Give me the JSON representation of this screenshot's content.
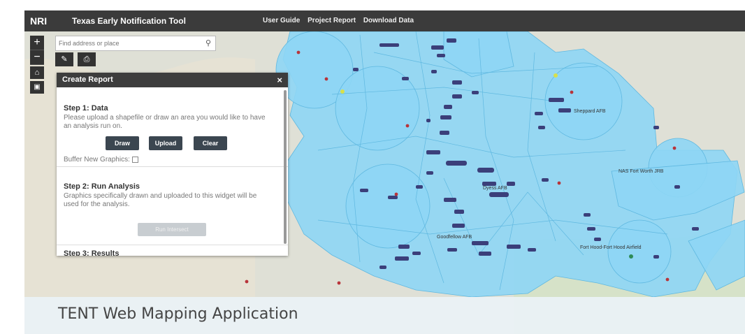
{
  "header": {
    "logo": "NRI",
    "title": "Texas Early Notification Tool",
    "nav": [
      "User Guide",
      "Project Report",
      "Download Data"
    ]
  },
  "map_controls": {
    "zoom_in": "+",
    "zoom_out": "−",
    "home_icon": "home-icon",
    "locate_icon": "locate-icon"
  },
  "search": {
    "placeholder": "Find address or place",
    "icon": "search-icon"
  },
  "panel": {
    "title": "Create Report",
    "close": "×",
    "step1": {
      "title": "Step 1: Data",
      "description": "Please upload a shapefile or draw an area you would like to have an analysis run on.",
      "buttons": [
        "Draw",
        "Upload",
        "Clear"
      ],
      "buffer_label": "Buffer New Graphics:"
    },
    "step2": {
      "title": "Step 2: Run Analysis",
      "description": "Graphics specifically drawn and uploaded to this widget will be used for the analysis.",
      "button": "Run Intersect"
    },
    "step3": {
      "title": "Step 3: Results"
    }
  },
  "map_labels": [
    "Sheppard AFB",
    "Dyess AFB",
    "NAS Fort Worth JRB",
    "Goodfellow AFB",
    "Fort Hood-Fort Hood Airfield"
  ],
  "banner": {
    "title": "TENT Web Mapping Application"
  },
  "colors": {
    "zone_fill": "#8ed6f5",
    "zone_stroke": "#5fb8e0",
    "site_marker": "#3b3f7a",
    "topbar": "#3b3b3b"
  }
}
